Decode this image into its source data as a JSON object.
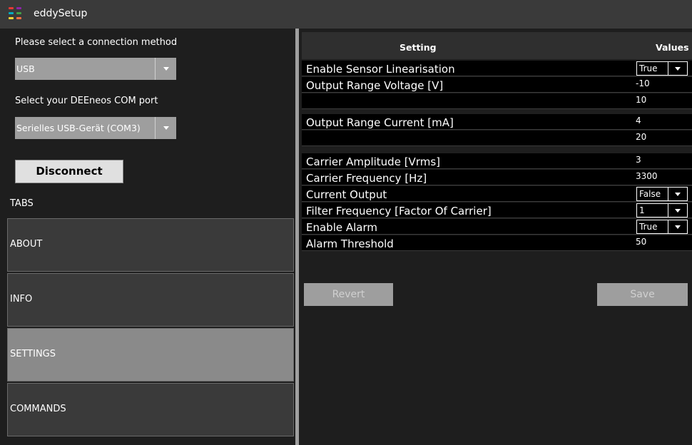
{
  "app": {
    "title": "eddySetup",
    "logo_colors": [
      "#e53935",
      "#8e24aa",
      "#00acc1",
      "#43a047",
      "#fdd835",
      "#ff7043"
    ]
  },
  "left_panel": {
    "connection_label": "Please select a connection method",
    "connection_value": "USB",
    "port_label": "Select your DEEneos COM port",
    "port_value": "Serielles USB-Gerät (COM3)",
    "disconnect_label": "Disconnect",
    "tabs_label": "TABS",
    "tabs": [
      {
        "label": "ABOUT",
        "active": false
      },
      {
        "label": "INFO",
        "active": false
      },
      {
        "label": "SETTINGS",
        "active": true
      },
      {
        "label": "COMMANDS",
        "active": false
      }
    ]
  },
  "grid": {
    "header_setting": "Setting",
    "header_values": "Values",
    "rows": [
      {
        "name": "Enable Sensor Linearisation",
        "value": "True",
        "type": "dropdown"
      },
      {
        "name": "Output Range Voltage [V]",
        "value": "-10",
        "type": "text"
      },
      {
        "name": "",
        "value": "10",
        "type": "text"
      },
      {
        "name": "Output Range Current [mA]",
        "value": "4",
        "type": "text"
      },
      {
        "name": "",
        "value": "20",
        "type": "text"
      },
      {
        "name": "Carrier Amplitude [Vrms]",
        "value": "3",
        "type": "text"
      },
      {
        "name": "Carrier Frequency [Hz]",
        "value": "3300",
        "type": "text"
      },
      {
        "name": "Current Output",
        "value": "False",
        "type": "dropdown"
      },
      {
        "name": "Filter Frequency [Factor Of Carrier]",
        "value": "1",
        "type": "dropdown"
      },
      {
        "name": "Enable Alarm",
        "value": "True",
        "type": "dropdown"
      },
      {
        "name": "Alarm Threshold",
        "value": "50",
        "type": "text"
      }
    ]
  },
  "buttons": {
    "revert": "Revert",
    "save": "Save"
  }
}
